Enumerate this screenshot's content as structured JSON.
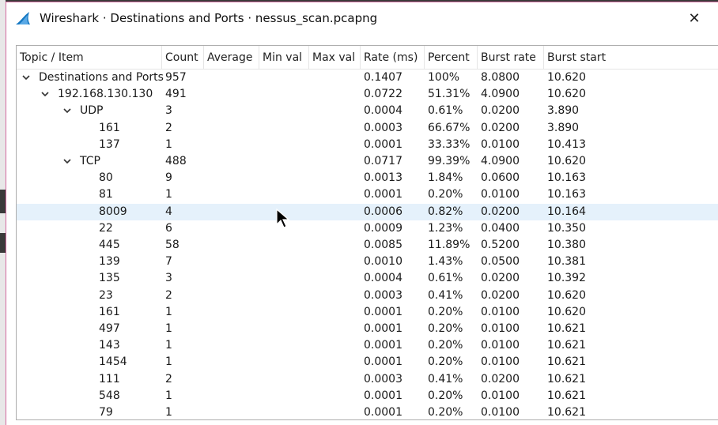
{
  "window": {
    "title": "Wireshark · Destinations and Ports · nessus_scan.pcapng",
    "close_glyph": "✕"
  },
  "columns": [
    "Topic / Item",
    "Count",
    "Average",
    "Min val",
    "Max val",
    "Rate (ms)",
    "Percent",
    "Burst rate",
    "Burst start"
  ],
  "rows": [
    {
      "label": "Destinations and Ports",
      "count": "957",
      "rate": "0.1407",
      "percent": "100%",
      "burst_rate": "8.0800",
      "burst_start": "10.620",
      "level": 0,
      "expanded": true
    },
    {
      "label": "192.168.130.130",
      "count": "491",
      "rate": "0.0722",
      "percent": "51.31%",
      "burst_rate": "4.0900",
      "burst_start": "10.620",
      "level": 1,
      "expanded": true
    },
    {
      "label": "UDP",
      "count": "3",
      "rate": "0.0004",
      "percent": "0.61%",
      "burst_rate": "0.0200",
      "burst_start": "3.890",
      "level": 2,
      "expanded": true
    },
    {
      "label": "161",
      "count": "2",
      "rate": "0.0003",
      "percent": "66.67%",
      "burst_rate": "0.0200",
      "burst_start": "3.890",
      "level": 3
    },
    {
      "label": "137",
      "count": "1",
      "rate": "0.0001",
      "percent": "33.33%",
      "burst_rate": "0.0100",
      "burst_start": "10.413",
      "level": 3
    },
    {
      "label": "TCP",
      "count": "488",
      "rate": "0.0717",
      "percent": "99.39%",
      "burst_rate": "4.0900",
      "burst_start": "10.620",
      "level": 2,
      "expanded": true
    },
    {
      "label": "80",
      "count": "9",
      "rate": "0.0013",
      "percent": "1.84%",
      "burst_rate": "0.0600",
      "burst_start": "10.163",
      "level": 3
    },
    {
      "label": "81",
      "count": "1",
      "rate": "0.0001",
      "percent": "0.20%",
      "burst_rate": "0.0100",
      "burst_start": "10.163",
      "level": 3
    },
    {
      "label": "8009",
      "count": "4",
      "rate": "0.0006",
      "percent": "0.82%",
      "burst_rate": "0.0200",
      "burst_start": "10.164",
      "level": 3,
      "selected": true
    },
    {
      "label": "22",
      "count": "6",
      "rate": "0.0009",
      "percent": "1.23%",
      "burst_rate": "0.0400",
      "burst_start": "10.350",
      "level": 3
    },
    {
      "label": "445",
      "count": "58",
      "rate": "0.0085",
      "percent": "11.89%",
      "burst_rate": "0.5200",
      "burst_start": "10.380",
      "level": 3
    },
    {
      "label": "139",
      "count": "7",
      "rate": "0.0010",
      "percent": "1.43%",
      "burst_rate": "0.0500",
      "burst_start": "10.381",
      "level": 3
    },
    {
      "label": "135",
      "count": "3",
      "rate": "0.0004",
      "percent": "0.61%",
      "burst_rate": "0.0200",
      "burst_start": "10.392",
      "level": 3
    },
    {
      "label": "23",
      "count": "2",
      "rate": "0.0003",
      "percent": "0.41%",
      "burst_rate": "0.0200",
      "burst_start": "10.620",
      "level": 3
    },
    {
      "label": "161",
      "count": "1",
      "rate": "0.0001",
      "percent": "0.20%",
      "burst_rate": "0.0100",
      "burst_start": "10.620",
      "level": 3
    },
    {
      "label": "497",
      "count": "1",
      "rate": "0.0001",
      "percent": "0.20%",
      "burst_rate": "0.0100",
      "burst_start": "10.621",
      "level": 3
    },
    {
      "label": "143",
      "count": "1",
      "rate": "0.0001",
      "percent": "0.20%",
      "burst_rate": "0.0100",
      "burst_start": "10.621",
      "level": 3
    },
    {
      "label": "1454",
      "count": "1",
      "rate": "0.0001",
      "percent": "0.20%",
      "burst_rate": "0.0100",
      "burst_start": "10.621",
      "level": 3
    },
    {
      "label": "111",
      "count": "2",
      "rate": "0.0003",
      "percent": "0.41%",
      "burst_rate": "0.0200",
      "burst_start": "10.621",
      "level": 3
    },
    {
      "label": "548",
      "count": "1",
      "rate": "0.0001",
      "percent": "0.20%",
      "burst_rate": "0.0100",
      "burst_start": "10.621",
      "level": 3
    },
    {
      "label": "79",
      "count": "1",
      "rate": "0.0001",
      "percent": "0.20%",
      "burst_rate": "0.0100",
      "burst_start": "10.621",
      "level": 3
    }
  ],
  "icons": {
    "app": "wireshark-fin-icon",
    "expander": "chevron-down-icon",
    "pointer": "mouse-cursor-icon"
  },
  "colors": {
    "selected_row": "#e5f1fb",
    "wireshark_blue": "#1679c3",
    "window_border": "#d46aa0"
  }
}
